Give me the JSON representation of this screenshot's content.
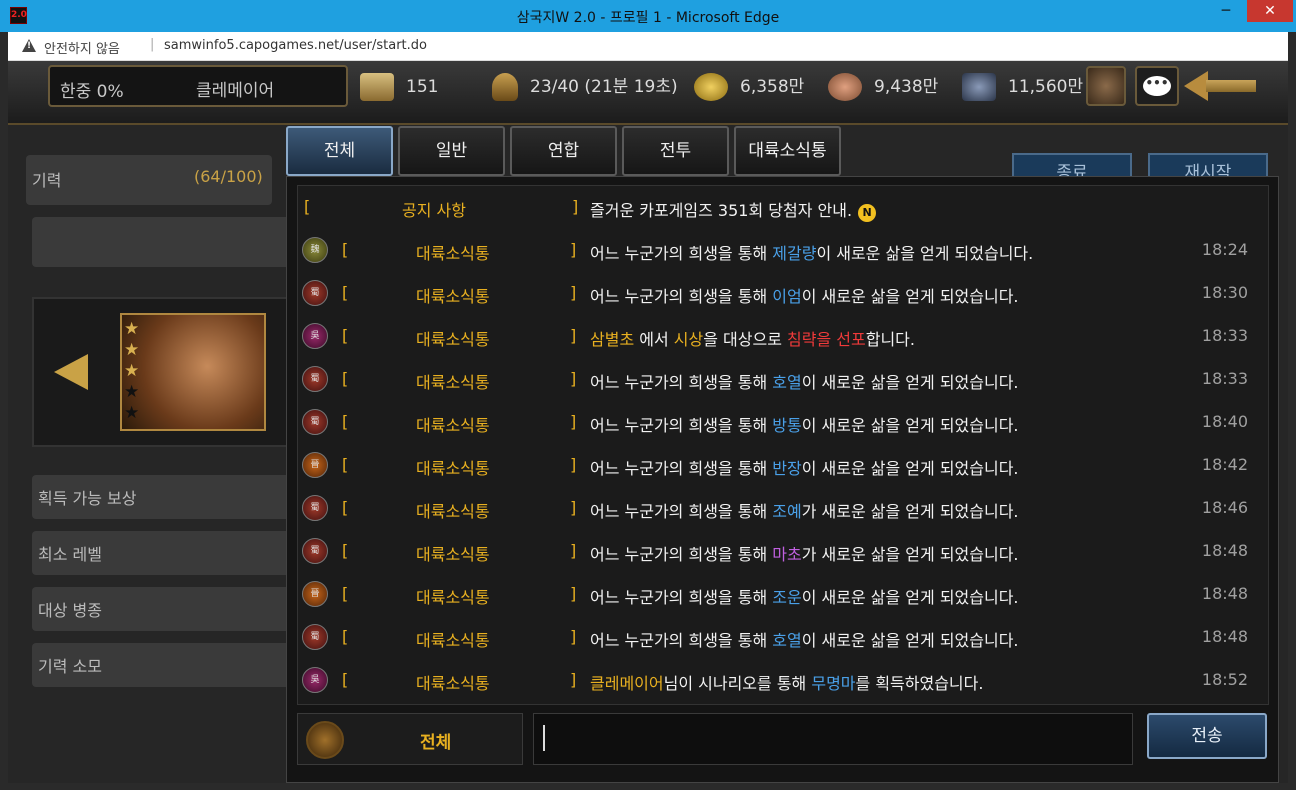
{
  "window": {
    "title": "삼국지W 2.0 - 프로필 1 - Microsoft Edge",
    "app_icon_label": "2.0"
  },
  "addressbar": {
    "security_label": "안전하지 않음",
    "separator": "|",
    "url": "samwinfo5.capogames.net/user/start.do"
  },
  "topbar": {
    "influence": "한중 0%",
    "username": "클레메이어",
    "stats": [
      {
        "icon": "scroll-icon",
        "value": "151"
      },
      {
        "icon": "runner-icon",
        "value": "23/40 (21분 19초)"
      },
      {
        "icon": "gold-ingot-icon",
        "value": "6,358만"
      },
      {
        "icon": "food-sack-icon",
        "value": "9,438만"
      },
      {
        "icon": "iron-ore-icon",
        "value": "11,560만"
      }
    ],
    "chat_bubble_text": "•••"
  },
  "left_panel": {
    "energy_label": "기력",
    "energy_value": "(64/100)",
    "rows": [
      "획득 가능 보상",
      "최소 레벨",
      "대상 병종",
      "기력 소모"
    ],
    "stars_filled": 3,
    "stars_total": 5,
    "star_char": "★"
  },
  "background_buttons": [
    "종료",
    "재시작"
  ],
  "chat": {
    "tabs": [
      "전체",
      "일반",
      "연합",
      "전투",
      "대륙소식통"
    ],
    "active_tab": 0,
    "notice": {
      "left_bracket": "[",
      "channel": "공지 사항",
      "right_bracket": "]",
      "text": "즐거운 카포게임즈 351회 당첨자 안내.",
      "icon_letter": "N"
    },
    "messages": [
      {
        "badge_color": "olive",
        "badge_label": "魏",
        "channel": "대륙소식통",
        "pre": "어느 누군가의 희생을 통해 ",
        "name": "제갈량",
        "name_color": "blue",
        "post": "이 새로운 삶을 얻게 되었습니다.",
        "time": "18:24"
      },
      {
        "badge_color": "red",
        "badge_label": "蜀",
        "channel": "대륙소식통",
        "pre": "어느 누군가의 희생을 통해 ",
        "name": "이엄",
        "name_color": "blue",
        "post": "이 새로운 삶을 얻게 되었습니다.",
        "time": "18:30"
      },
      {
        "badge_color": "purple",
        "badge_label": "吳",
        "channel": "대륙소식통",
        "pre": "",
        "name": "삼별초",
        "name_color": "gold",
        "post": "",
        "time": "18:33",
        "kind": "war"
      },
      {
        "badge_color": "red",
        "badge_label": "蜀",
        "channel": "대륙소식통",
        "pre": "어느 누군가의 희생을 통해 ",
        "name": "호열",
        "name_color": "blue",
        "post": "이 새로운 삶을 얻게 되었습니다.",
        "time": "18:33"
      },
      {
        "badge_color": "red",
        "badge_label": "蜀",
        "channel": "대륙소식통",
        "pre": "어느 누군가의 희생을 통해 ",
        "name": "방통",
        "name_color": "blue",
        "post": "이 새로운 삶을 얻게 되었습니다.",
        "time": "18:40"
      },
      {
        "badge_color": "orange",
        "badge_label": "晉",
        "channel": "대륙소식통",
        "pre": "어느 누군가의 희생을 통해 ",
        "name": "반장",
        "name_color": "blue",
        "post": "이 새로운 삶을 얻게 되었습니다.",
        "time": "18:42"
      },
      {
        "badge_color": "red",
        "badge_label": "蜀",
        "channel": "대륙소식통",
        "pre": "어느 누군가의 희생을 통해 ",
        "name": "조예",
        "name_color": "blue",
        "post": "가 새로운 삶을 얻게 되었습니다.",
        "time": "18:46"
      },
      {
        "badge_color": "red",
        "badge_label": "蜀",
        "channel": "대륙소식통",
        "pre": "어느 누군가의 희생을 통해 ",
        "name": "마초",
        "name_color": "purple",
        "post": "가 새로운 삶을 얻게 되었습니다.",
        "time": "18:48"
      },
      {
        "badge_color": "orange",
        "badge_label": "晉",
        "channel": "대륙소식통",
        "pre": "어느 누군가의 희생을 통해 ",
        "name": "조운",
        "name_color": "blue",
        "post": "이 새로운 삶을 얻게 되었습니다.",
        "time": "18:48"
      },
      {
        "badge_color": "red",
        "badge_label": "蜀",
        "channel": "대륙소식통",
        "pre": "어느 누군가의 희생을 통해 ",
        "name": "호열",
        "name_color": "blue",
        "post": "이 새로운 삶을 얻게 되었습니다.",
        "time": "18:48"
      },
      {
        "badge_color": "purple",
        "badge_label": "吳",
        "channel": "대륙소식통",
        "pre": "",
        "name": "클레메이어",
        "name_color": "gold",
        "post": "님이 시나리오를 통해 ",
        "name2": "무명마",
        "post2": "를 획득하였습니다.",
        "time": "18:52"
      }
    ],
    "war_message": {
      "attacker": "삼별초",
      "mid": " 에서 ",
      "target": "시상",
      "mid2": "을 대상으로 ",
      "action": "침략을 선포",
      "end": "합니다."
    },
    "bracket_left": "[",
    "bracket_right": "]",
    "input": {
      "channel_label": "전체",
      "value": "",
      "send_label": "전송"
    }
  }
}
